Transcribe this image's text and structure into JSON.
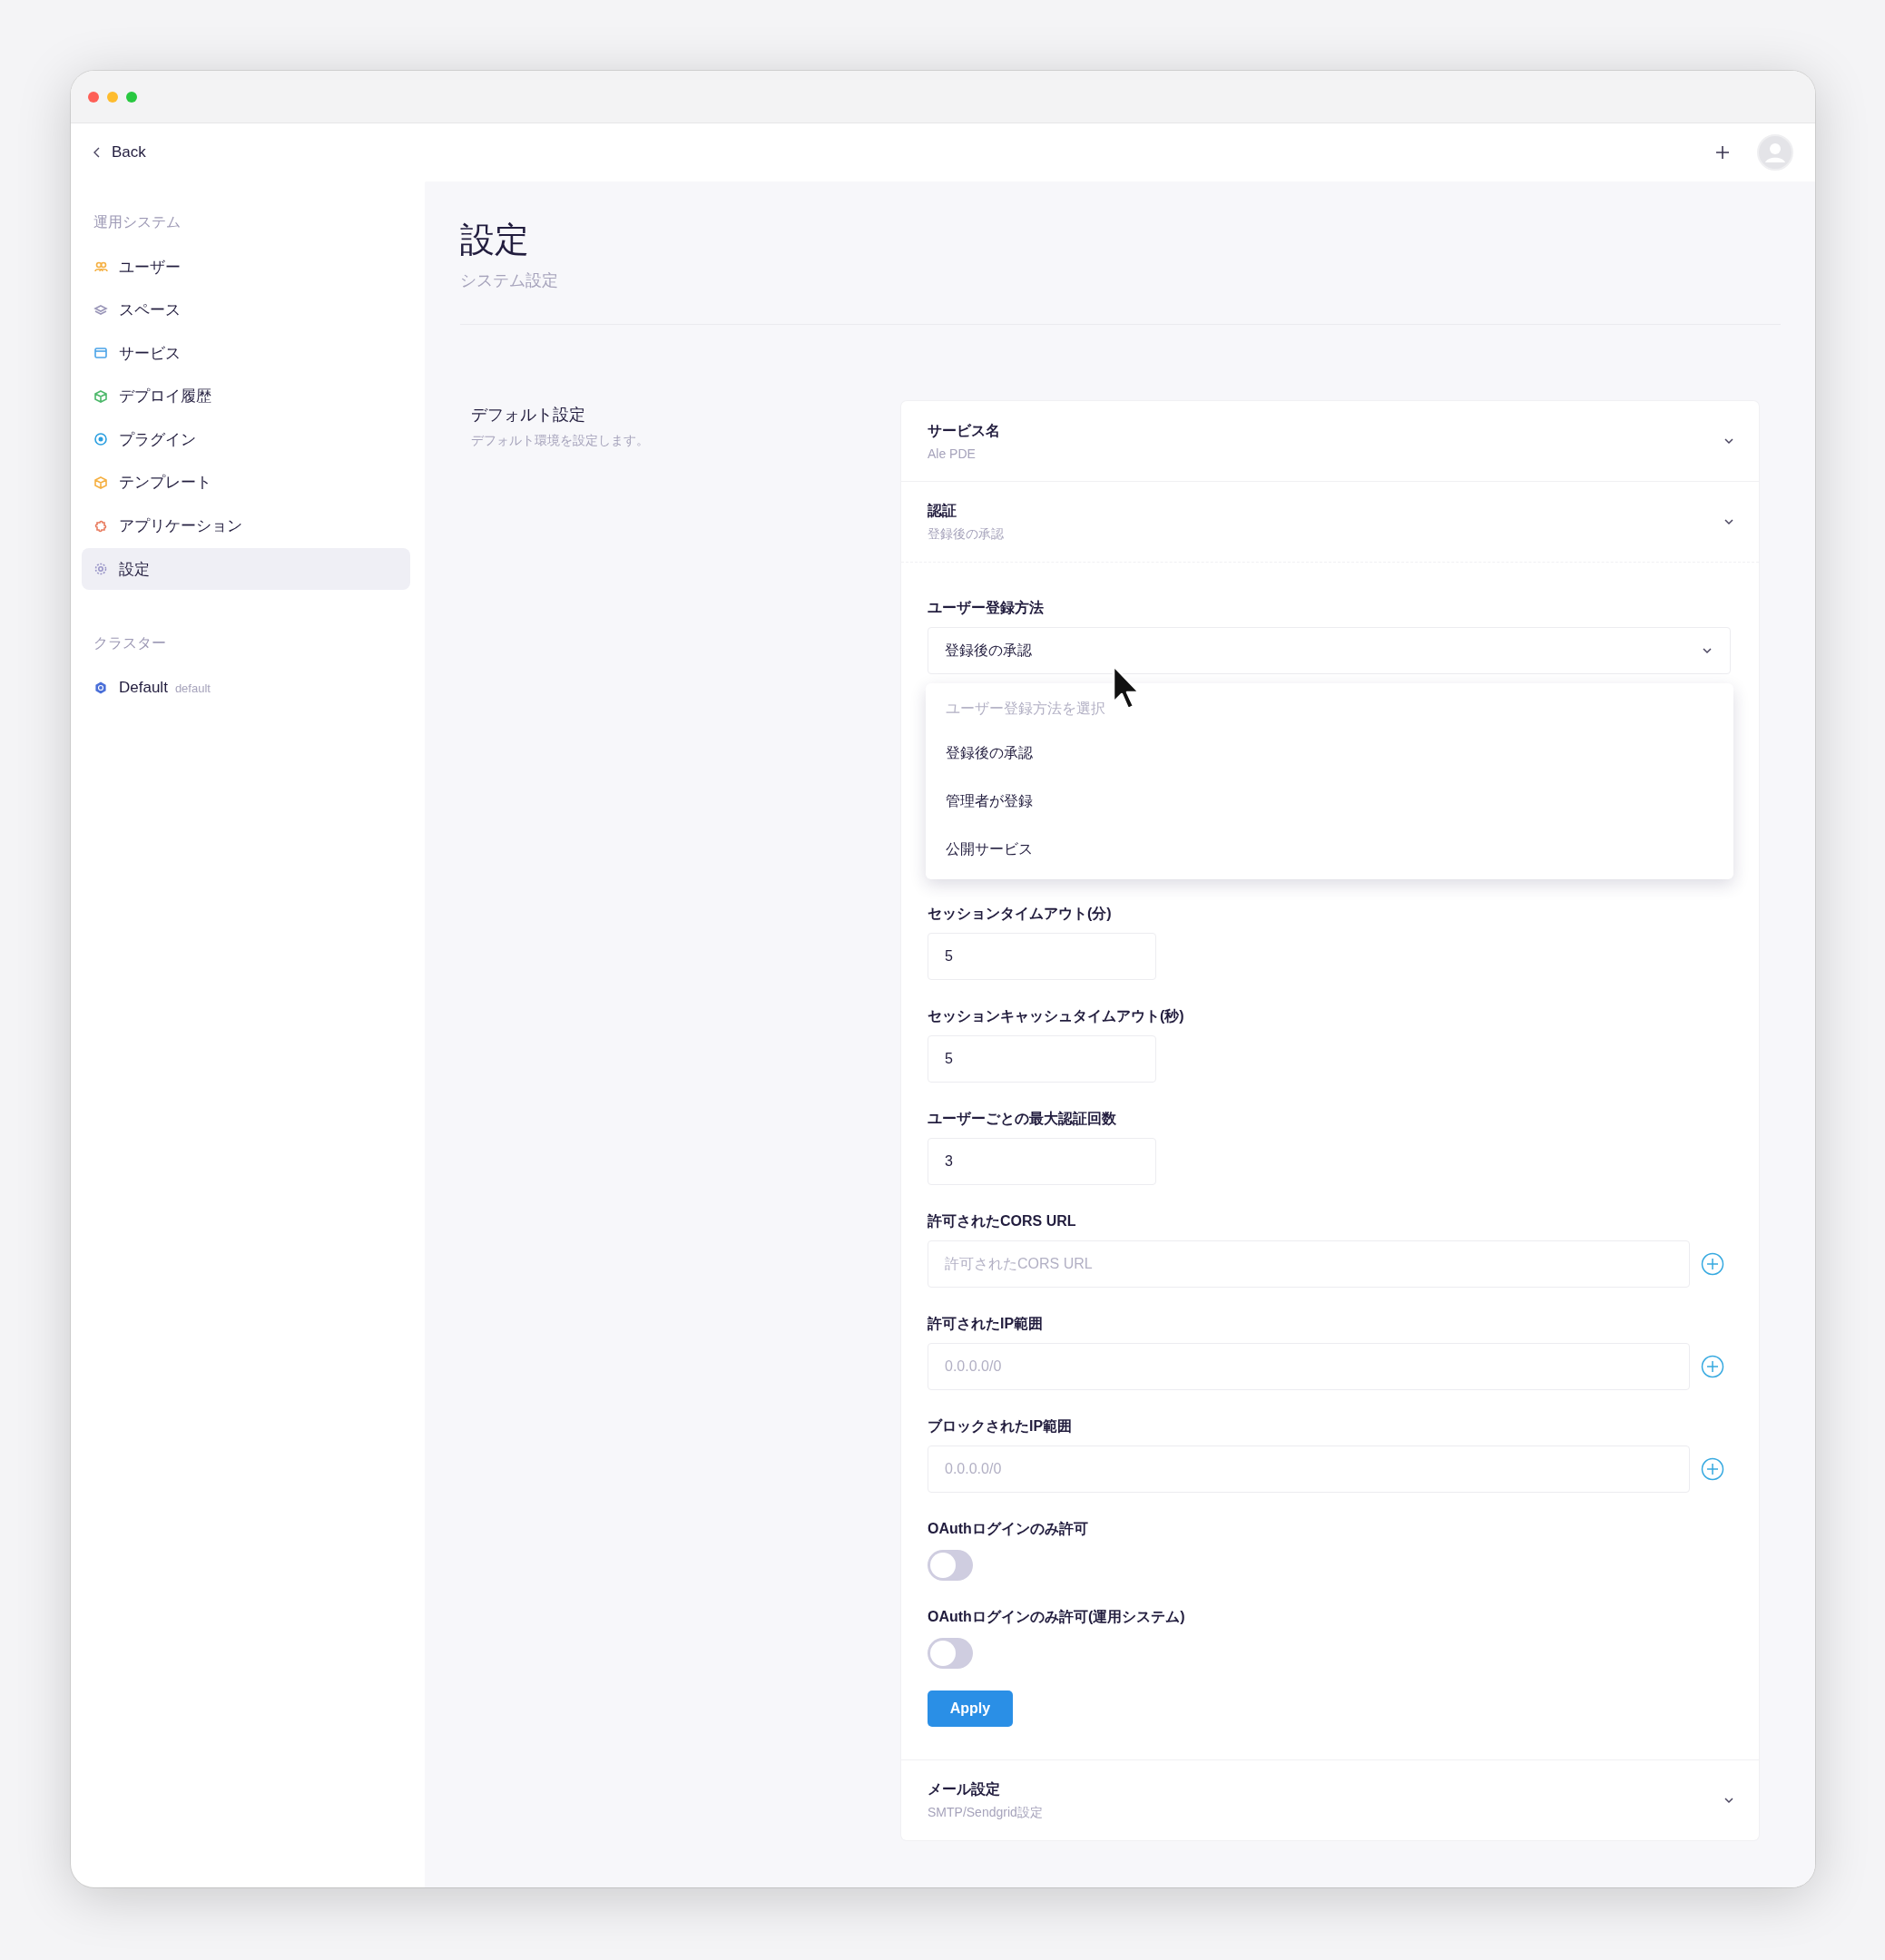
{
  "header": {
    "back": "Back"
  },
  "sidebar": {
    "sections": [
      {
        "title": "運用システム",
        "items": [
          {
            "label": "ユーザー",
            "selected": false
          },
          {
            "label": "スペース",
            "selected": false
          },
          {
            "label": "サービス",
            "selected": false
          },
          {
            "label": "デプロイ履歴",
            "selected": false
          },
          {
            "label": "プラグイン",
            "selected": false
          },
          {
            "label": "テンプレート",
            "selected": false
          },
          {
            "label": "アプリケーション",
            "selected": false
          },
          {
            "label": "設定",
            "selected": true
          }
        ]
      },
      {
        "title": "クラスター",
        "items": [
          {
            "label": "Default",
            "badge": "default",
            "selected": false
          }
        ]
      }
    ]
  },
  "page": {
    "title": "設定",
    "subtitle": "システム設定"
  },
  "section": {
    "title": "デフォルト設定",
    "description": "デフォルト環境を設定します。"
  },
  "panels": [
    {
      "title": "サービス名",
      "summary": "Ale PDE"
    },
    {
      "title": "認証",
      "summary": "登録後の承認",
      "fields": [
        {
          "kind": "select",
          "label": "ユーザー登録方法",
          "value": "登録後の承認",
          "open": true,
          "menu": {
            "header": "ユーザー登録方法を選択",
            "options": [
              "登録後の承認",
              "管理者が登録",
              "公開サービス"
            ]
          }
        },
        {
          "kind": "number",
          "label": "セッションタイムアウト(分)",
          "value": "5"
        },
        {
          "kind": "number",
          "label": "セッションキャッシュタイムアウト(秒)",
          "value": "5"
        },
        {
          "kind": "number",
          "label": "ユーザーごとの最大認証回数",
          "value": "3"
        },
        {
          "kind": "list",
          "label": "許可されたCORS URL",
          "placeholder": "許可されたCORS URL"
        },
        {
          "kind": "list",
          "label": "許可されたIP範囲",
          "placeholder": "0.0.0.0/0"
        },
        {
          "kind": "list",
          "label": "ブロックされたIP範囲",
          "placeholder": "0.0.0.0/0"
        },
        {
          "kind": "toggle",
          "label": "OAuthログインのみ許可",
          "on": false
        },
        {
          "kind": "toggle",
          "label": "OAuthログインのみ許可(運用システム)",
          "on": false
        }
      ],
      "apply": "Apply"
    },
    {
      "title": "メール設定",
      "summary": "SMTP/Sendgrid設定"
    }
  ]
}
